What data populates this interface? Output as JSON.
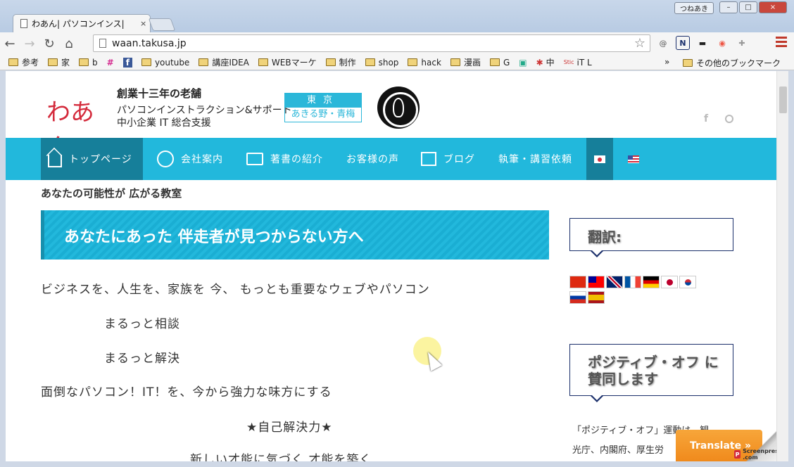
{
  "browser": {
    "tab_title": "わあん| パソコンインス|",
    "tab_close": "×",
    "profile": "つねあき",
    "window_buttons": [
      "–",
      "□",
      "×"
    ],
    "url": "waan.takusa.jp",
    "nav": {
      "back": "←",
      "forward": "→",
      "reload": "↻",
      "home": "⌂"
    },
    "star": "☆",
    "extensions": [
      "@",
      "N",
      "▬",
      "◉",
      "✚"
    ],
    "bookmarks": [
      "参考",
      "家",
      "b",
      "",
      "",
      "youtube",
      "講座IDEA",
      "WEBマーケ",
      "制作",
      "shop",
      "hack",
      "漫画",
      "G",
      "",
      "中",
      "iT L"
    ],
    "bookmarks_more": "»",
    "bookmarks_other": "その他のブックマーク"
  },
  "site": {
    "logo_text": "わあん",
    "tagline1": "創業十三年の老舗",
    "tagline2": "パソコンインストラクション&サポート",
    "tagline3": "中小企業 IT 総合支援",
    "location_top": "東京",
    "location_bottom": "あきる野・青梅",
    "social_fb": "f",
    "nav": [
      {
        "label": "トップページ",
        "icon": "home-icon"
      },
      {
        "label": "会社案内",
        "icon": "user-icon"
      },
      {
        "label": "著書の紹介",
        "icon": "wallet-icon"
      },
      {
        "label": "お客様の声",
        "icon": ""
      },
      {
        "label": "ブログ",
        "icon": "gift-icon"
      },
      {
        "label": "執筆・講習依頼",
        "icon": ""
      }
    ],
    "subtitle": "あなたの可能性が 広がる教室"
  },
  "main": {
    "headline": "あなたにあった 伴走者が見つからない方へ",
    "paragraphs": [
      "ビジネスを、人生を、家族を 今、 もっとも重要なウェブやパソコン",
      "まるっと相談",
      "まるっと解決",
      "面倒なパソコン！IT！を、今から強力な味方にする",
      "★自己解決力★",
      "新しい才能に気づく 才能を築く"
    ]
  },
  "sidebar": {
    "translate_title": "翻訳:",
    "positive_title_1": "ポジティブ・オフ に",
    "positive_title_2": "賛同します",
    "text1": "「ポジティブ・オフ」運動は、観",
    "text2": "光庁、内閣府、厚生労"
  },
  "overlay": {
    "translate_button": "Translate »",
    "watermark": "Screenpresso .com"
  }
}
